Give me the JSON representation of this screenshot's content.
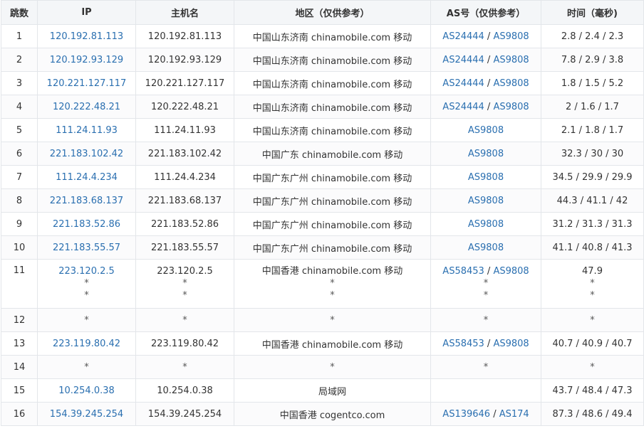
{
  "headers": {
    "hop": "跳数",
    "ip": "IP",
    "host": "主机名",
    "region": "地区（仅供参考）",
    "as": "AS号（仅供参考）",
    "time": "时间（毫秒)"
  },
  "rows": [
    {
      "hop": "1",
      "ip": [
        "120.192.81.113"
      ],
      "host": [
        "120.192.81.113"
      ],
      "region": [
        "中国山东济南 chinamobile.com 移动"
      ],
      "as": [
        [
          "AS24444",
          "AS9808"
        ]
      ],
      "time": [
        "2.8 / 2.4 / 2.3"
      ]
    },
    {
      "hop": "2",
      "ip": [
        "120.192.93.129"
      ],
      "host": [
        "120.192.93.129"
      ],
      "region": [
        "中国山东济南 chinamobile.com 移动"
      ],
      "as": [
        [
          "AS24444",
          "AS9808"
        ]
      ],
      "time": [
        "7.8 / 2.9 / 3.8"
      ]
    },
    {
      "hop": "3",
      "ip": [
        "120.221.127.117"
      ],
      "host": [
        "120.221.127.117"
      ],
      "region": [
        "中国山东济南 chinamobile.com 移动"
      ],
      "as": [
        [
          "AS24444",
          "AS9808"
        ]
      ],
      "time": [
        "1.8 / 1.5 / 5.2"
      ]
    },
    {
      "hop": "4",
      "ip": [
        "120.222.48.21"
      ],
      "host": [
        "120.222.48.21"
      ],
      "region": [
        "中国山东济南 chinamobile.com 移动"
      ],
      "as": [
        [
          "AS24444",
          "AS9808"
        ]
      ],
      "time": [
        "2 / 1.6 / 1.7"
      ]
    },
    {
      "hop": "5",
      "ip": [
        "111.24.11.93"
      ],
      "host": [
        "111.24.11.93"
      ],
      "region": [
        "中国山东济南 chinamobile.com 移动"
      ],
      "as": [
        [
          "AS9808"
        ]
      ],
      "time": [
        "2.1 / 1.8 / 1.7"
      ]
    },
    {
      "hop": "6",
      "ip": [
        "221.183.102.42"
      ],
      "host": [
        "221.183.102.42"
      ],
      "region": [
        "中国广东 chinamobile.com 移动"
      ],
      "as": [
        [
          "AS9808"
        ]
      ],
      "time": [
        "32.3 / 30 / 30"
      ]
    },
    {
      "hop": "7",
      "ip": [
        "111.24.4.234"
      ],
      "host": [
        "111.24.4.234"
      ],
      "region": [
        "中国广东广州 chinamobile.com 移动"
      ],
      "as": [
        [
          "AS9808"
        ]
      ],
      "time": [
        "34.5 / 29.9 / 29.9"
      ]
    },
    {
      "hop": "8",
      "ip": [
        "221.183.68.137"
      ],
      "host": [
        "221.183.68.137"
      ],
      "region": [
        "中国广东广州 chinamobile.com 移动"
      ],
      "as": [
        [
          "AS9808"
        ]
      ],
      "time": [
        "44.3 / 41.1 / 42"
      ]
    },
    {
      "hop": "9",
      "ip": [
        "221.183.52.86"
      ],
      "host": [
        "221.183.52.86"
      ],
      "region": [
        "中国广东广州 chinamobile.com 移动"
      ],
      "as": [
        [
          "AS9808"
        ]
      ],
      "time": [
        "31.2 / 31.3 / 31.3"
      ]
    },
    {
      "hop": "10",
      "ip": [
        "221.183.55.57"
      ],
      "host": [
        "221.183.55.57"
      ],
      "region": [
        "中国广东广州 chinamobile.com 移动"
      ],
      "as": [
        [
          "AS9808"
        ]
      ],
      "time": [
        "41.1 / 40.8 / 41.3"
      ]
    },
    {
      "hop": "11",
      "ip": [
        "223.120.2.5",
        "*",
        "*"
      ],
      "host": [
        "223.120.2.5",
        "*",
        "*"
      ],
      "region": [
        "中国香港 chinamobile.com 移动",
        "*",
        "*"
      ],
      "as": [
        [
          "AS58453",
          "AS9808"
        ],
        [
          "*"
        ],
        [
          "*"
        ]
      ],
      "time": [
        "47.9",
        "*",
        "*"
      ]
    },
    {
      "hop": "12",
      "ip": [
        "*"
      ],
      "host": [
        "*"
      ],
      "region": [
        "*"
      ],
      "as": [
        [
          "*"
        ]
      ],
      "time": [
        "*"
      ]
    },
    {
      "hop": "13",
      "ip": [
        "223.119.80.42"
      ],
      "host": [
        "223.119.80.42"
      ],
      "region": [
        "中国香港 chinamobile.com 移动"
      ],
      "as": [
        [
          "AS58453",
          "AS9808"
        ]
      ],
      "time": [
        "40.7 / 40.9 / 40.7"
      ]
    },
    {
      "hop": "14",
      "ip": [
        "*"
      ],
      "host": [
        "*"
      ],
      "region": [
        "*"
      ],
      "as": [
        [
          "*"
        ]
      ],
      "time": [
        "*"
      ]
    },
    {
      "hop": "15",
      "ip": [
        "10.254.0.38"
      ],
      "host": [
        "10.254.0.38"
      ],
      "region": [
        "局域网"
      ],
      "as": [
        []
      ],
      "time": [
        "43.7 / 48.4 / 47.3"
      ]
    },
    {
      "hop": "16",
      "ip": [
        "154.39.245.254"
      ],
      "host": [
        "154.39.245.254"
      ],
      "region": [
        "中国香港 cogentco.com"
      ],
      "as": [
        [
          "AS139646",
          "AS174"
        ]
      ],
      "time": [
        "87.3 / 48.6 / 49.4"
      ]
    }
  ],
  "colors": {
    "link": "#2a6fb0",
    "border": "#e3e6ea",
    "header_bg": "#f4f6f8"
  }
}
